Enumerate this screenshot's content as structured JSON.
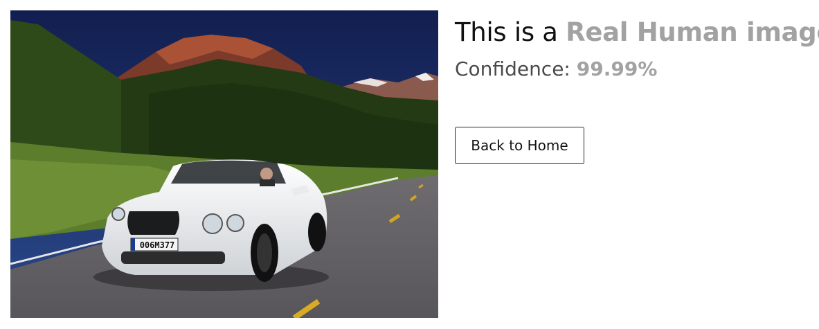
{
  "photo": {
    "plate_text": "006M377"
  },
  "result": {
    "title_prefix": "This is a ",
    "title_highlight": "Real Human image",
    "confidence_label": "Confidence: ",
    "confidence_value": "99.99%"
  },
  "actions": {
    "back_label": "Back to Home"
  },
  "colors": {
    "highlight": "#a2a2a2",
    "text": "#111111",
    "border": "#212529"
  }
}
